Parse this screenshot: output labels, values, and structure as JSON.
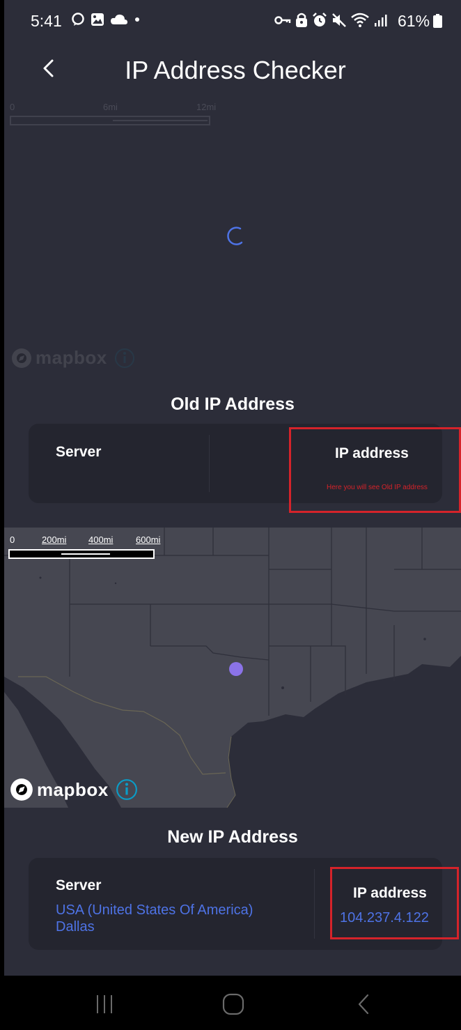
{
  "status_bar": {
    "time": "5:41",
    "battery": "61%",
    "left_icons": [
      "chat-icon",
      "image-icon",
      "cloud-icon",
      "dot-icon"
    ],
    "right_icons": [
      "vpn-key-icon",
      "lock-icon",
      "alarm-icon",
      "mute-icon",
      "wifi-icon",
      "signal-icon",
      "battery-icon"
    ]
  },
  "header": {
    "title": "IP Address Checker",
    "back_icon": "chevron-left-icon"
  },
  "old_map": {
    "scale_labels": [
      "0",
      "6mi",
      "12mi"
    ],
    "attribution": "mapbox",
    "loading": true
  },
  "old_section": {
    "title": "Old IP Address",
    "server_label": "Server",
    "ip_label": "IP  address",
    "hint": "Here you will see Old IP address"
  },
  "new_map": {
    "scale_labels": [
      "0",
      "200mi",
      "400mi",
      "600mi"
    ],
    "attribution": "mapbox",
    "marker_color": "#8b73e8"
  },
  "new_section": {
    "title": "New IP Address",
    "server_label": "Server",
    "server_value_line1": "USA (United States Of America)",
    "server_value_line2": "Dallas",
    "ip_label": "IP  address",
    "ip_value": "104.237.4.122"
  },
  "nav_bar": {
    "items": [
      "recent-apps-icon",
      "home-icon",
      "back-icon"
    ]
  },
  "colors": {
    "background": "#2c2d39",
    "card": "#24252f",
    "accent": "#4e73e6",
    "highlight": "#d5232a"
  }
}
